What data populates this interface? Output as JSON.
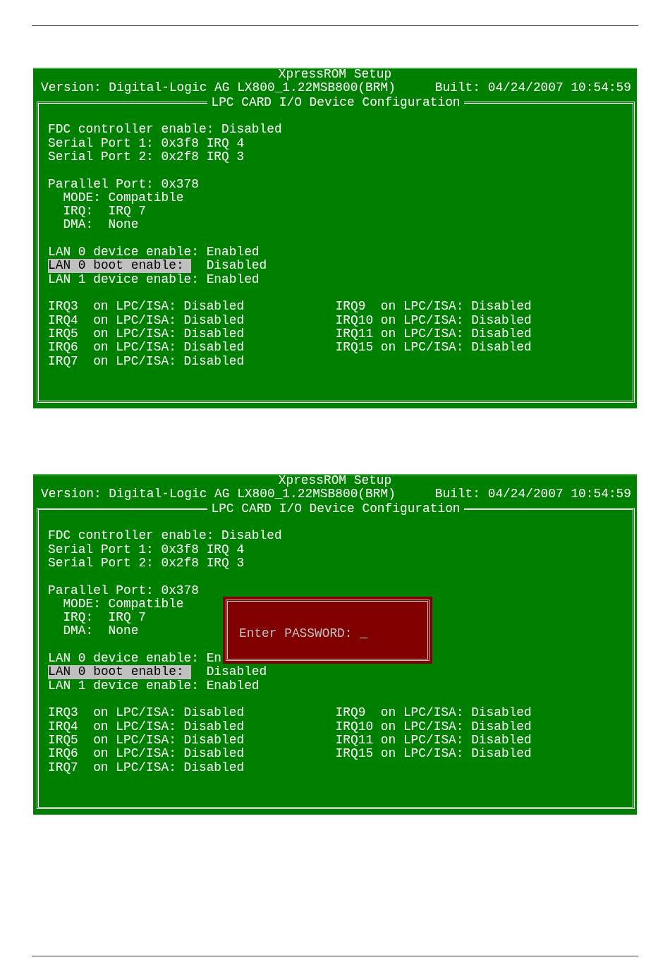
{
  "screens": [
    {
      "title": "XpressROM Setup",
      "version": "Version: Digital-Logic AG LX800_1.22MSB800(BRM)",
      "built": "Built: 04/24/2007 10:54:59",
      "section_title": "LPC CARD I/O Device Configuration",
      "groups": [
        [
          {
            "label": "FDC controller enable:",
            "value": "Disabled",
            "selected": false
          },
          {
            "label": "Serial Port 1:",
            "value": "0x3f8 IRQ 4",
            "selected": false
          },
          {
            "label": "Serial Port 2:",
            "value": "0x2f8 IRQ 3",
            "selected": false
          }
        ],
        [
          {
            "label": "Parallel Port:",
            "value": "0x378",
            "selected": false,
            "children": [
              {
                "label": "MODE:",
                "value": "Compatible",
                "selected": false
              },
              {
                "label": "IRQ:",
                "value": "IRQ 7",
                "selected": false
              },
              {
                "label": "DMA:",
                "value": "None",
                "selected": false
              }
            ]
          }
        ],
        [
          {
            "label": "LAN 0 device enable:",
            "value": "Enabled",
            "selected": false
          },
          {
            "label": "LAN 0 boot enable:",
            "value": "Disabled",
            "selected": true
          },
          {
            "label": "LAN 1 device enable:",
            "value": "Enabled",
            "selected": false
          }
        ]
      ],
      "irq_columns": [
        [
          {
            "irq": "IRQ3",
            "bus": "on LPC/ISA:",
            "value": "Disabled",
            "selected": false
          },
          {
            "irq": "IRQ4",
            "bus": "on LPC/ISA:",
            "value": "Disabled",
            "selected": false
          },
          {
            "irq": "IRQ5",
            "bus": "on LPC/ISA:",
            "value": "Disabled",
            "selected": false
          },
          {
            "irq": "IRQ6",
            "bus": "on LPC/ISA:",
            "value": "Disabled",
            "selected": false
          },
          {
            "irq": "IRQ7",
            "bus": "on LPC/ISA:",
            "value": "Disabled",
            "selected": false
          }
        ],
        [
          {
            "irq": "IRQ9",
            "bus": "on LPC/ISA:",
            "value": "Disabled",
            "selected": false
          },
          {
            "irq": "IRQ10",
            "bus": "on LPC/ISA:",
            "value": "Disabled",
            "selected": false
          },
          {
            "irq": "IRQ11",
            "bus": "on LPC/ISA:",
            "value": "Disabled",
            "selected": false
          },
          {
            "irq": "IRQ15",
            "bus": "on LPC/ISA:",
            "value": "Disabled",
            "selected": false
          }
        ]
      ]
    },
    {
      "title": "XpressROM Setup",
      "version": "Version: Digital-Logic AG LX800_1.22MSB800(BRM)",
      "built": "Built: 04/24/2007 10:54:59",
      "section_title": "LPC CARD I/O Device Configuration",
      "groups": [
        [
          {
            "label": "FDC controller enable:",
            "value": "Disabled",
            "selected": false
          },
          {
            "label": "Serial Port 1:",
            "value": "0x3f8 IRQ 4",
            "selected": false
          },
          {
            "label": "Serial Port 2:",
            "value": "0x2f8 IRQ 3",
            "selected": false
          }
        ],
        [
          {
            "label": "Parallel Port:",
            "value": "0x378",
            "selected": false,
            "children": [
              {
                "label": "MODE:",
                "value": "Compatible",
                "selected": false
              },
              {
                "label": "IRQ:",
                "value": "IRQ 7",
                "selected": false
              },
              {
                "label": "DMA:",
                "value": "None",
                "selected": false
              }
            ]
          }
        ],
        [
          {
            "label": "LAN 0 device enable:",
            "value": "En",
            "selected": false
          },
          {
            "label": "LAN 0 boot enable:",
            "value": "Disabled",
            "selected": true
          },
          {
            "label": "LAN 1 device enable:",
            "value": "Enabled",
            "selected": false
          }
        ]
      ],
      "irq_columns": [
        [
          {
            "irq": "IRQ3",
            "bus": "on LPC/ISA:",
            "value": "Disabled",
            "selected": false
          },
          {
            "irq": "IRQ4",
            "bus": "on LPC/ISA:",
            "value": "Disabled",
            "selected": false
          },
          {
            "irq": "IRQ5",
            "bus": "on LPC/ISA:",
            "value": "Disabled",
            "selected": false
          },
          {
            "irq": "IRQ6",
            "bus": "on LPC/ISA:",
            "value": "Disabled",
            "selected": false
          },
          {
            "irq": "IRQ7",
            "bus": "on LPC/ISA:",
            "value": "Disabled",
            "selected": false
          }
        ],
        [
          {
            "irq": "IRQ9",
            "bus": "on LPC/ISA:",
            "value": "Disabled",
            "selected": false
          },
          {
            "irq": "IRQ10",
            "bus": "on LPC/ISA:",
            "value": "Disabled",
            "selected": false
          },
          {
            "irq": "IRQ11",
            "bus": "on LPC/ISA:",
            "value": "Disabled",
            "selected": false
          },
          {
            "irq": "IRQ15",
            "bus": "on LPC/ISA:",
            "value": "Disabled",
            "selected": false
          }
        ]
      ],
      "dialog": {
        "prompt": "Enter PASSWORD:",
        "cursor": "_"
      }
    }
  ]
}
